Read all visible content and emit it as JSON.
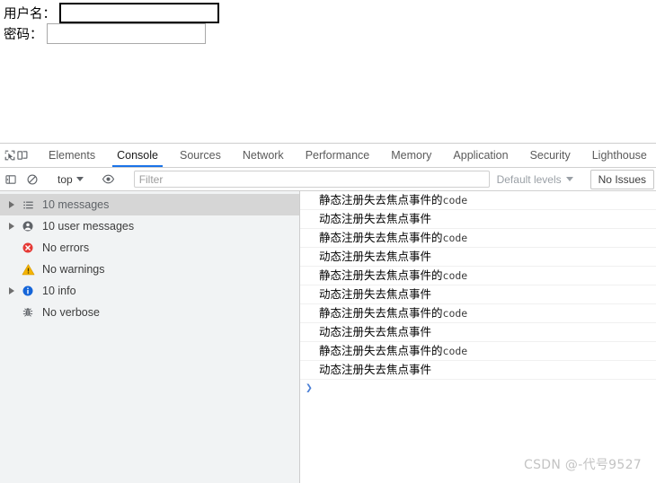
{
  "web_page": {
    "username_label": "用户名：",
    "username_value": "",
    "password_label": "密码：",
    "password_value": ""
  },
  "devtools": {
    "toolbar_icons": [
      {
        "name": "inspect-element-icon",
        "glyph": "inspect"
      },
      {
        "name": "device-toolbar-icon",
        "glyph": "device"
      }
    ],
    "tabs": [
      {
        "label": "Elements",
        "active": false
      },
      {
        "label": "Console",
        "active": true
      },
      {
        "label": "Sources",
        "active": false
      },
      {
        "label": "Network",
        "active": false
      },
      {
        "label": "Performance",
        "active": false
      },
      {
        "label": "Memory",
        "active": false
      },
      {
        "label": "Application",
        "active": false
      },
      {
        "label": "Security",
        "active": false
      },
      {
        "label": "Lighthouse",
        "active": false
      }
    ],
    "console_toolbar": {
      "sidebar_toggle_icon": "console-sidebar-toggle-icon",
      "clear_console_icon": "clear-console-icon",
      "context_selector": "top",
      "eye_icon": "live-expression-eye-icon",
      "filter_placeholder": "Filter",
      "filter_value": "",
      "levels_label": "Default levels",
      "issues_label": "No Issues"
    },
    "sidebar": [
      {
        "label": "10 messages",
        "icon": "list-icon",
        "expandable": true,
        "selected": true
      },
      {
        "label": "10 user messages",
        "icon": "user-icon",
        "expandable": true,
        "selected": false
      },
      {
        "label": "No errors",
        "icon": "error-icon",
        "expandable": false,
        "selected": false
      },
      {
        "label": "No warnings",
        "icon": "warning-icon",
        "expandable": false,
        "selected": false
      },
      {
        "label": "10 info",
        "icon": "info-icon",
        "expandable": true,
        "selected": false
      },
      {
        "label": "No verbose",
        "icon": "verbose-bug-icon",
        "expandable": false,
        "selected": false
      }
    ],
    "messages": [
      {
        "text": "静态注册失去焦点事件的",
        "code": "code"
      },
      {
        "text": "动态注册失去焦点事件",
        "code": ""
      },
      {
        "text": "静态注册失去焦点事件的",
        "code": "code"
      },
      {
        "text": "动态注册失去焦点事件",
        "code": ""
      },
      {
        "text": "静态注册失去焦点事件的",
        "code": "code"
      },
      {
        "text": "动态注册失去焦点事件",
        "code": ""
      },
      {
        "text": "静态注册失去焦点事件的",
        "code": "code"
      },
      {
        "text": "动态注册失去焦点事件",
        "code": ""
      },
      {
        "text": "静态注册失去焦点事件的",
        "code": "code"
      },
      {
        "text": "动态注册失去焦点事件",
        "code": ""
      }
    ],
    "prompt_caret": "❯"
  },
  "watermark": "CSDN @-代号9527",
  "colors": {
    "accent": "#1a73e8",
    "error": "#e53935",
    "warning": "#f5b400",
    "info": "#1565d8",
    "sidebar_bg": "#f1f3f4",
    "selected_row": "#d6d6d6"
  }
}
